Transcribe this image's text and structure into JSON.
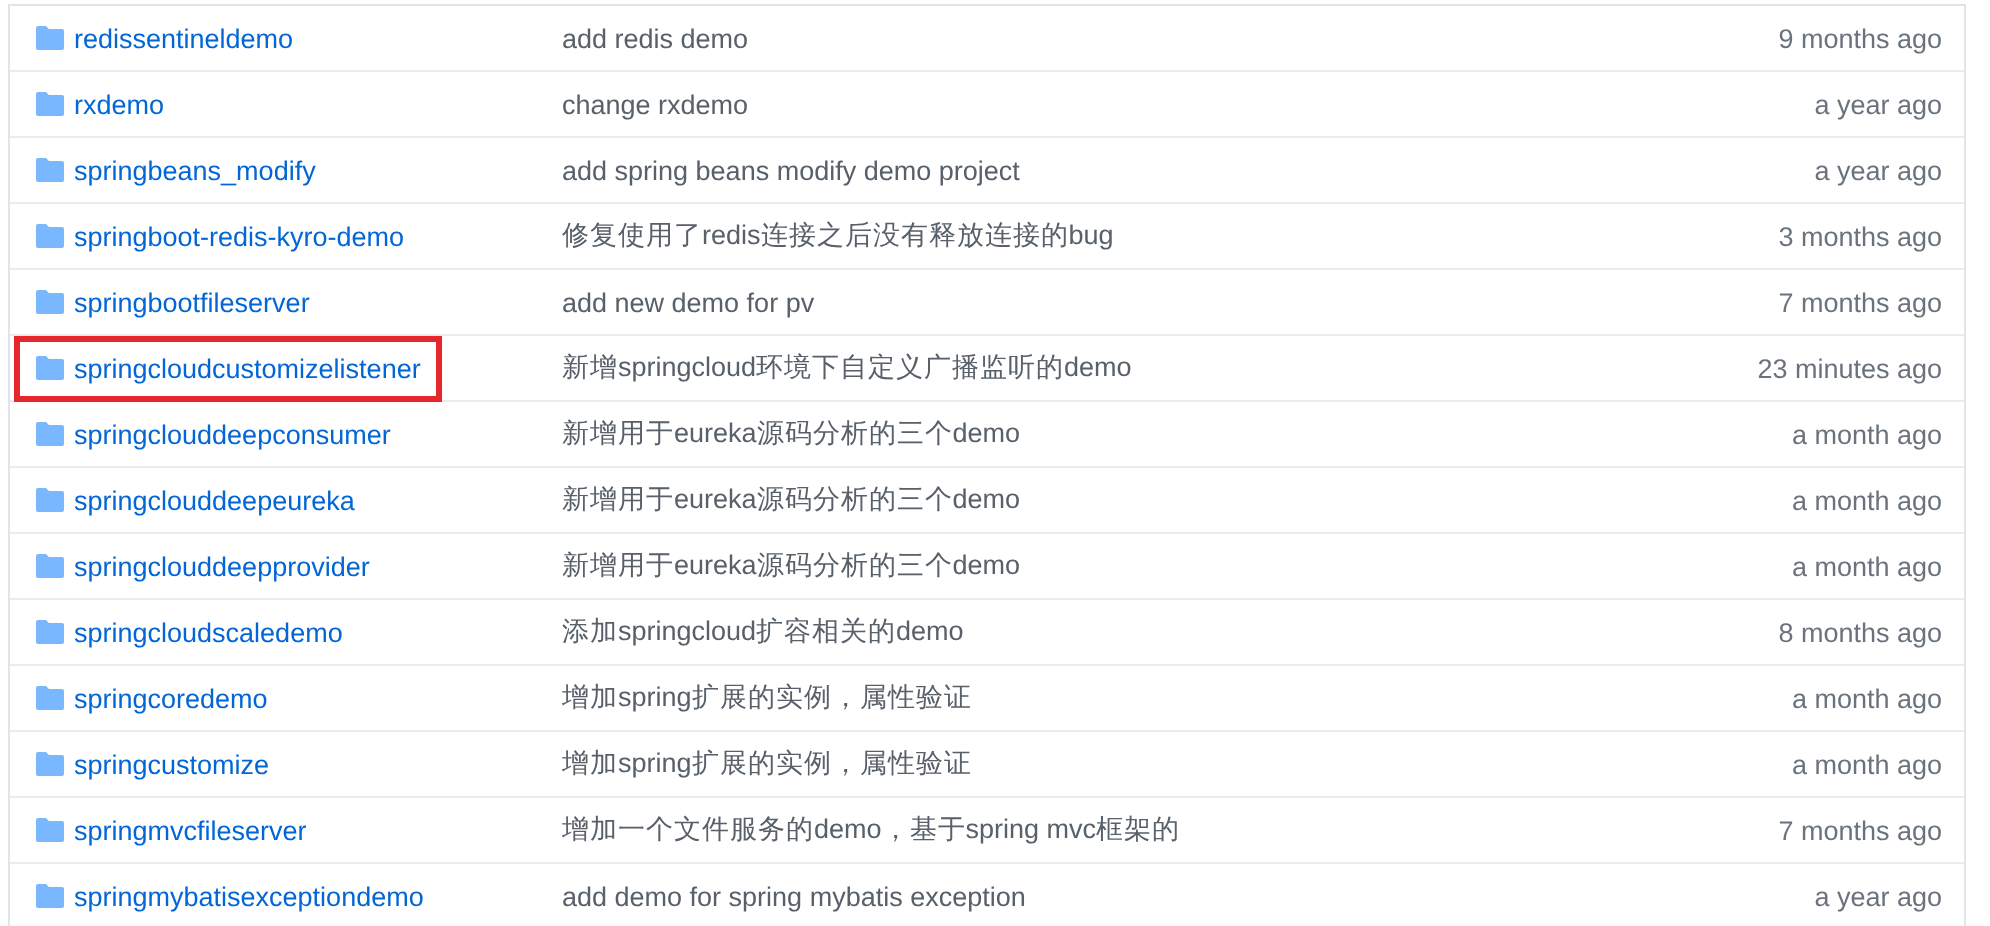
{
  "rows": [
    {
      "name": "redissentineldemo",
      "message": "add redis demo",
      "age": "9 months ago",
      "highlighted": false
    },
    {
      "name": "rxdemo",
      "message": "change rxdemo",
      "age": "a year ago",
      "highlighted": false
    },
    {
      "name": "springbeans_modify",
      "message": "add spring beans modify demo project",
      "age": "a year ago",
      "highlighted": false
    },
    {
      "name": "springboot-redis-kyro-demo",
      "message": "修复使用了redis连接之后没有释放连接的bug",
      "age": "3 months ago",
      "highlighted": false
    },
    {
      "name": "springbootfileserver",
      "message": "add new demo for pv",
      "age": "7 months ago",
      "highlighted": false
    },
    {
      "name": "springcloudcustomizelistener",
      "message": "新增springcloud环境下自定义广播监听的demo",
      "age": "23 minutes ago",
      "highlighted": true
    },
    {
      "name": "springclouddeepconsumer",
      "message": "新增用于eureka源码分析的三个demo",
      "age": "a month ago",
      "highlighted": false
    },
    {
      "name": "springclouddeepeureka",
      "message": "新增用于eureka源码分析的三个demo",
      "age": "a month ago",
      "highlighted": false
    },
    {
      "name": "springclouddeepprovider",
      "message": "新增用于eureka源码分析的三个demo",
      "age": "a month ago",
      "highlighted": false
    },
    {
      "name": "springcloudscaledemo",
      "message": "添加springcloud扩容相关的demo",
      "age": "8 months ago",
      "highlighted": false
    },
    {
      "name": "springcoredemo",
      "message": "增加spring扩展的实例，属性验证",
      "age": "a month ago",
      "highlighted": false
    },
    {
      "name": "springcustomize",
      "message": "增加spring扩展的实例，属性验证",
      "age": "a month ago",
      "highlighted": false
    },
    {
      "name": "springmvcfileserver",
      "message": "增加一个文件服务的demo，基于spring mvc框架的",
      "age": "7 months ago",
      "highlighted": false
    },
    {
      "name": "springmybatisexceptiondemo",
      "message": "add demo for spring mybatis exception",
      "age": "a year ago",
      "highlighted": false
    }
  ]
}
